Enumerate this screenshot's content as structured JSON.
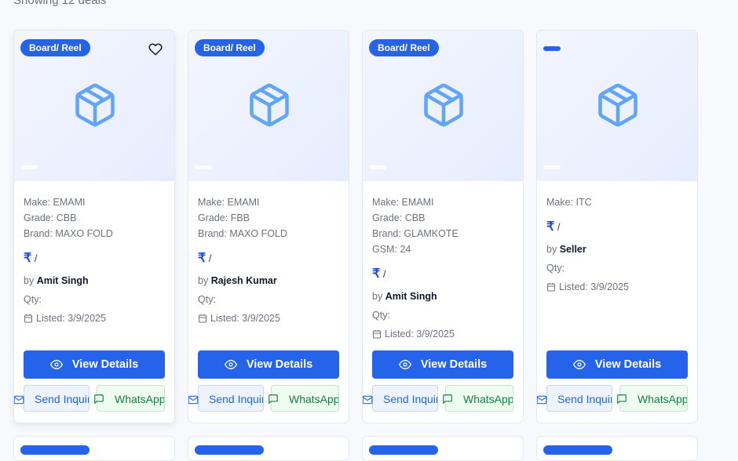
{
  "header": {
    "showing": "Showing 12 deals"
  },
  "cards": [
    {
      "badge": "Board/ Reel",
      "make_label": "Make:",
      "make": "EMAMI",
      "grade_label": "Grade:",
      "grade": "CBB",
      "brand_label": "Brand:",
      "brand": "MAXO FOLD",
      "price_symbol": "₹",
      "price_sep": "/",
      "by_label": "by",
      "seller": "Amit Singh",
      "qty_label": "Qty:",
      "listed": "Listed: 3/9/2025",
      "view_label": "View Details",
      "inquiry_label": "Send Inquiry",
      "whatsapp_label": "WhatsApp"
    },
    {
      "badge": "Board/ Reel",
      "make_label": "Make:",
      "make": "EMAMI",
      "grade_label": "Grade:",
      "grade": "FBB",
      "brand_label": "Brand:",
      "brand": "MAXO FOLD",
      "price_symbol": "₹",
      "price_sep": "/",
      "by_label": "by",
      "seller": "Rajesh Kumar",
      "qty_label": "Qty:",
      "listed": "Listed: 3/9/2025",
      "view_label": "View Details",
      "inquiry_label": "Send Inquiry",
      "whatsapp_label": "WhatsApp"
    },
    {
      "badge": "Board/ Reel",
      "make_label": "Make:",
      "make": "EMAMI",
      "grade_label": "Grade:",
      "grade": "CBB",
      "brand_label": "Brand:",
      "brand": "GLAMKOTE",
      "gsm_label": "GSM:",
      "gsm": "24",
      "price_symbol": "₹",
      "price_sep": "/",
      "by_label": "by",
      "seller": "Amit Singh",
      "qty_label": "Qty:",
      "listed": "Listed: 3/9/2025",
      "view_label": "View Details",
      "inquiry_label": "Send Inquiry",
      "whatsapp_label": "WhatsApp"
    },
    {
      "badge": "",
      "make_label": "Make:",
      "make": "ITC",
      "price_symbol": "₹",
      "price_sep": "/",
      "by_label": "by",
      "seller": "Seller",
      "qty_label": "Qty:",
      "listed": "Listed: 3/9/2025",
      "view_label": "View Details",
      "inquiry_label": "Send Inquiry",
      "whatsapp_label": "WhatsApp"
    }
  ],
  "colors": {
    "primary": "#2563eb",
    "whatsapp": "#15803d"
  },
  "icons": [
    "heart-icon",
    "package-icon",
    "calendar-icon",
    "eye-icon",
    "mail-icon",
    "message-icon"
  ]
}
